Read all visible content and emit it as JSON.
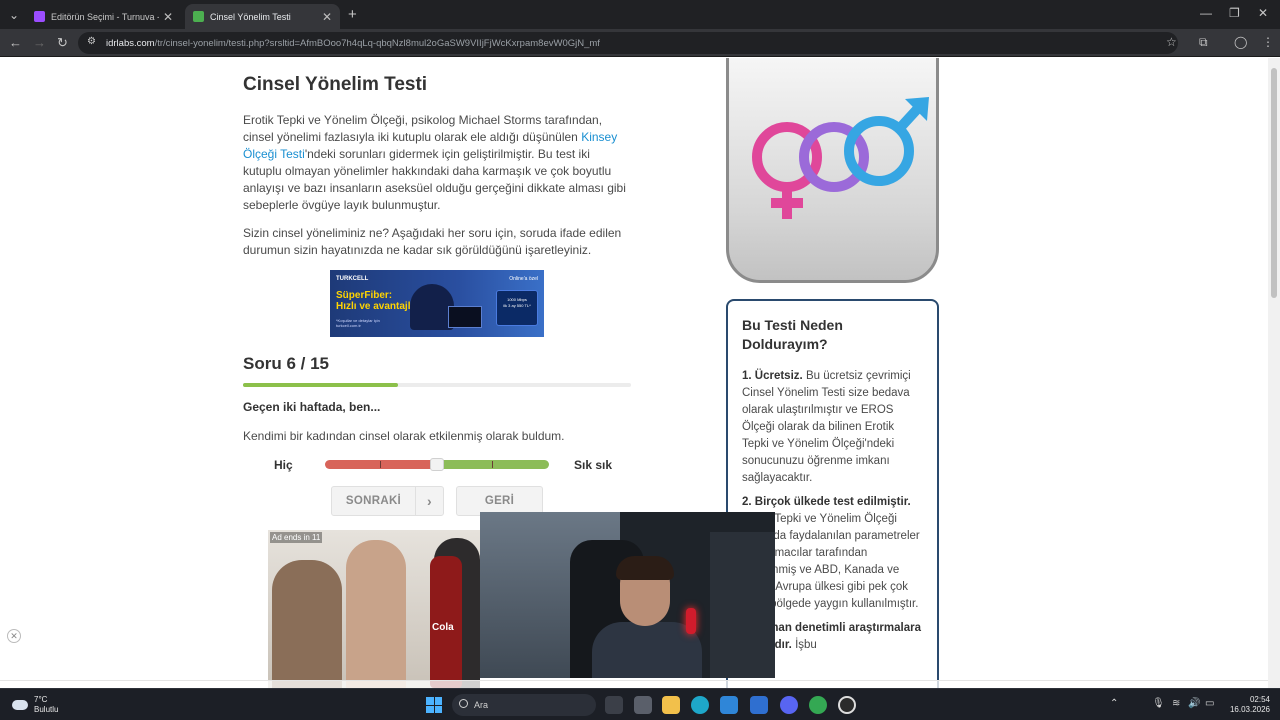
{
  "browser": {
    "tabs": [
      {
        "title": "Editörün Seçimi - Turnuva - Qu",
        "active": false,
        "favicon_color": "#9b4dff"
      },
      {
        "title": "Cinsel Yönelim Testi",
        "active": true,
        "favicon_color": "#4caf50"
      }
    ],
    "new_tab_icon": "plus-icon",
    "address": {
      "host": "idrlabs.com",
      "path": "/tr/cinsel-yonelim/testi.php?srsltid=AfmBOoo7h4qLq-qbqNzl8mul2oGaSW9VIIjFjWcKxrpam8evW0GjN_mf"
    }
  },
  "page": {
    "title": "Cinsel Yönelim Testi",
    "intro_before_link": "Erotik Tepki ve Yönelim Ölçeği, psikolog Michael Storms tarafından, cinsel yönelimi fazlasıyla iki kutuplu olarak ele aldığı düşünülen ",
    "intro_link": "Kinsey Ölçeği Testi",
    "intro_after_link": "'ndeki sorunları gidermek için geliştirilmiştir. Bu test iki kutuplu olmayan yönelimler hakkındaki daha karmaşık ve çok boyutlu anlayışı ve bazı insanların aseksüel olduğu gerçeğini dikkate alması gibi sebeplerle övgüye layık bulunmuştur.",
    "instruction": "Sizin cinsel yöneliminiz ne? Aşağıdaki her soru için, soruda ifade edilen durumun sizin hayatınızda ne kadar sık görüldüğünü işaretleyiniz.",
    "ad_banner": {
      "brand": "TURKCELL",
      "headline_1": "SüperFiber:",
      "headline_2": "Hızlı ve avantajlı!",
      "badge": "Online'a özel",
      "card_line_1": "1000 Mbps",
      "card_line_2": "ilk 3 ay 550 TL*",
      "fineprint": "*Koşullar ve detaylar için turkcell.com.tr"
    },
    "question": {
      "counter": "Soru 6 / 15",
      "progress_fraction": 0.4,
      "prompt": "Geçen iki haftada, ben...",
      "text": "Kendimi bir kadından cinsel olarak etkilenmiş olarak buldum.",
      "scale_left": "Hiç",
      "scale_right": "Sık sık",
      "slider_value": 0.5,
      "next_label": "SONRAKİ",
      "next_icon": "chevron-right-icon",
      "back_label": "GERİ"
    },
    "video_ad": {
      "label": "Ad ends in 11",
      "bottle_text": "Cola"
    },
    "sidebar": {
      "heading": "Bu Testi Neden Doldurayım?",
      "point1_title": "1. Ücretsiz.",
      "point1_body": "Bu ücretsiz çevrimiçi Cinsel Yönelim Testi size bedava olarak ulaştırılmıştır ve EROS Ölçeği olarak da bilinen Erotik Tepki ve Yönelim Ölçeği'ndeki sonucunuzu öğrenme imkanı sağlayacaktır.",
      "point2_title": "2. Birçok ülkede test edilmiştir.",
      "point2_body": "Erotik Tepki ve Yönelim Ölçeği dünyada faydalanılan parametreler araştırmacılar tarafından incelenmiş ve ABD, Kanada ve birkaç Avrupa ülkesi gibi pek çok farklı bölgede yaygın kullanılmıştır.",
      "point3_title": "3. Zaman denetimli araştırmalara dayalıdır.",
      "point3_body": "İşbu"
    }
  },
  "taskbar": {
    "weather_temp": "7°C",
    "weather_desc": "Bulutlu",
    "search_placeholder": "Ara",
    "time": "02:54",
    "date": "16.03.2026"
  },
  "colors": {
    "accent_link": "#1a8fd1",
    "progress": "#8cc04a",
    "slider_red": "#d8645a",
    "slider_green": "#8cbc58",
    "sidebar_border": "#2a4a6e"
  }
}
